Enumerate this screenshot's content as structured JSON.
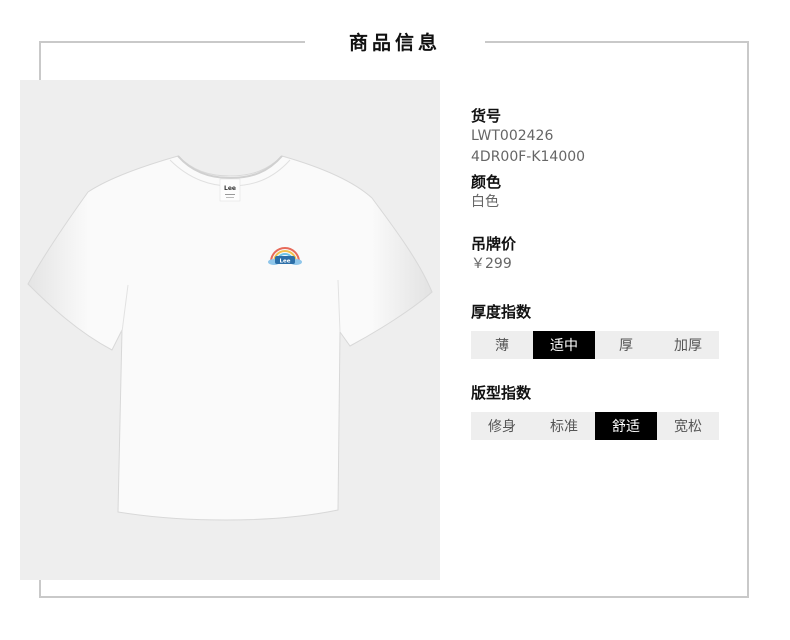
{
  "section_title": "商品信息",
  "product": {
    "sku_label": "货号",
    "sku_lines": [
      "LWT002426",
      "4DR00F-K14000"
    ],
    "color_label": "颜色",
    "color_value": "白色",
    "price_label": "吊牌价",
    "price_value": "￥299"
  },
  "thickness": {
    "label": "厚度指数",
    "options": [
      "薄",
      "适中",
      "厚",
      "加厚"
    ],
    "selected": "适中"
  },
  "fit": {
    "label": "版型指数",
    "options": [
      "修身",
      "标准",
      "舒适",
      "宽松"
    ],
    "selected": "舒适"
  },
  "image": {
    "subject": "white-tshirt",
    "brand_neck_label": "Lee",
    "chest_logo": "Lee",
    "background_color": "#eeeeee"
  }
}
